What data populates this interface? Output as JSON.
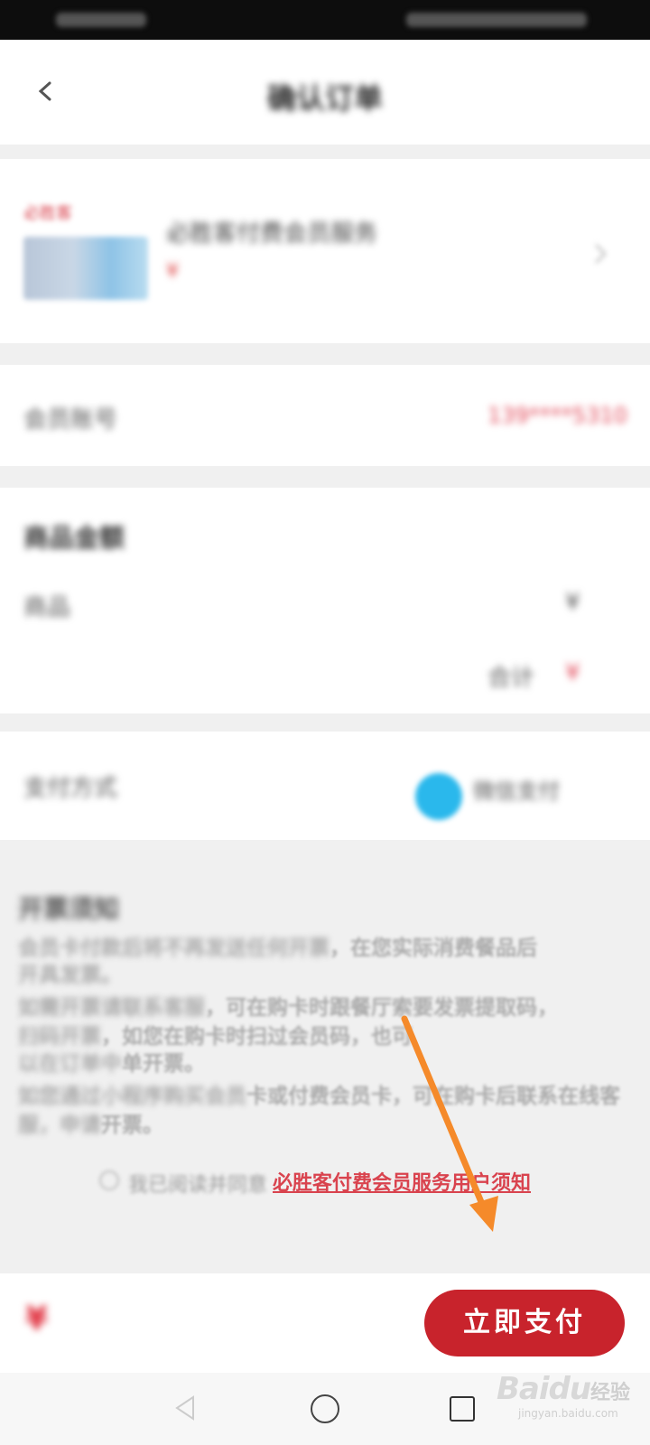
{
  "header": {
    "title": "确认订单"
  },
  "product": {
    "tag": "必胜客",
    "title": "必胜客付费会员服务",
    "price": "¥"
  },
  "phone_row": {
    "label": "会员账号",
    "value": "139****5310"
  },
  "details": {
    "title": "商品金额",
    "item_label": "商品",
    "item_value": "¥",
    "subtotal_label": "合计",
    "subtotal_value": "¥"
  },
  "payment": {
    "label": "支付方式",
    "method": "微信支付"
  },
  "notes": {
    "title": "开票须知",
    "lines": [
      {
        "blur": "会员卡付款后将不再发送任何开票",
        "clear": "，在您实际消费餐品后"
      },
      {
        "blur": "开具发票。",
        "clear": ""
      },
      {
        "blur": "如需开票请联系客服",
        "clear": "，可在购卡时跟餐厅索要发票提取码，"
      },
      {
        "blur": "扫码开票",
        "clear": "，如您在购卡时扫过会员码，也可"
      },
      {
        "blur": "以在订单中",
        "clear": "单开票。"
      },
      {
        "blur": "如您通过小程序购买会员",
        "clear": "卡或付费会员卡，可在购卡后联系在线客"
      },
      {
        "blur": "服，申请",
        "clear": "开票。"
      }
    ]
  },
  "agreement": {
    "prefix": "我已阅读并同意",
    "link": "必胜客付费会员服务用户须知"
  },
  "bottom": {
    "total": "¥",
    "pay_button": "立即支付"
  },
  "watermark": {
    "logo": "Baidu",
    "cn": "经验",
    "url": "jingyan.baidu.com"
  },
  "colors": {
    "accent": "#c8232c",
    "link": "#d9434e",
    "arrow": "#f58a2a"
  }
}
